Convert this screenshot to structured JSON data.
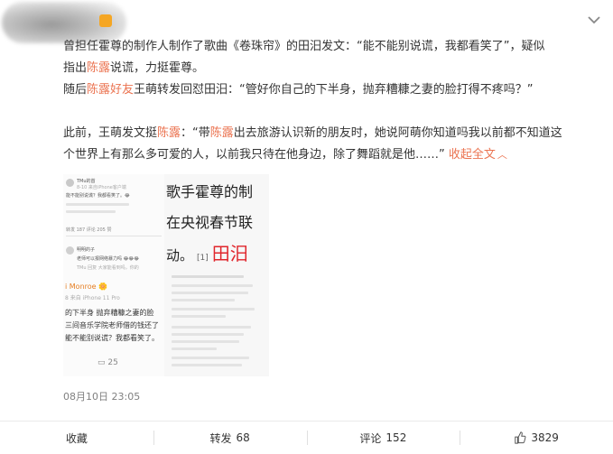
{
  "post": {
    "line1": "曾担任霍尊的制作人制作了歌曲《卷珠帘》的田汨发文：“能不能别说谎，我都看笑了”，疑似",
    "line2_pre": "指出",
    "line2_name": "陈露",
    "line2_post": "说谎，力挺霍尊。",
    "line3_pre": "随后",
    "line3_name": "陈露好友",
    "line3_post": "王萌转发回怼田汨：“管好你自己的下半身，抛弃糟糠之妻的脸打得不疼吗？”",
    "line4_pre": "此前，王萌发文挺",
    "line4_name1": "陈露",
    "line4_mid": "：“带",
    "line4_name2": "陈露",
    "line4_post": "出去旅游认识新的朋友时，她说阿萌你知道吗我以前都不知道这",
    "line5": "个世界上有那么多可爱的人，以前我只待在他身边，除了舞蹈就是他……”",
    "collapse_label": "收起全文",
    "time": "08月10日 23:05"
  },
  "image_left": {
    "user": "TMu的首",
    "sub": "8-10 来自iPhone客户端",
    "quote": "能不能别说谎？我都看笑了。😂",
    "tabs": "转发 187   评论 205   赞",
    "commenter": "明明的子",
    "comment": "老师可以报网络暴力吗 😂😂😂",
    "reply": "TMu 回复 大家能看到吗，你的",
    "monroe": "i Monroe 🌼",
    "phone": "8 来自 iPhone 11 Pro",
    "l1": "的下半身 抛弃糟糠之妻的脸",
    "l2": "三间音乐学院老师借的钱还了",
    "l3": "能不能别说谎？我都看笑了。",
    "count": "25"
  },
  "image_right": {
    "big1": "歌手霍尊的制",
    "big2": "在央视春节联",
    "big3_pre": "动。",
    "ref": "[1]",
    "big3_red": "田汨"
  },
  "toolbar": {
    "collect": "收藏",
    "repost": "转发",
    "repost_count": "68",
    "comment": "评论",
    "comment_count": "152",
    "like_count": "3829"
  },
  "colors": {
    "highlight": "#eb7350",
    "red": "#e0262c"
  }
}
